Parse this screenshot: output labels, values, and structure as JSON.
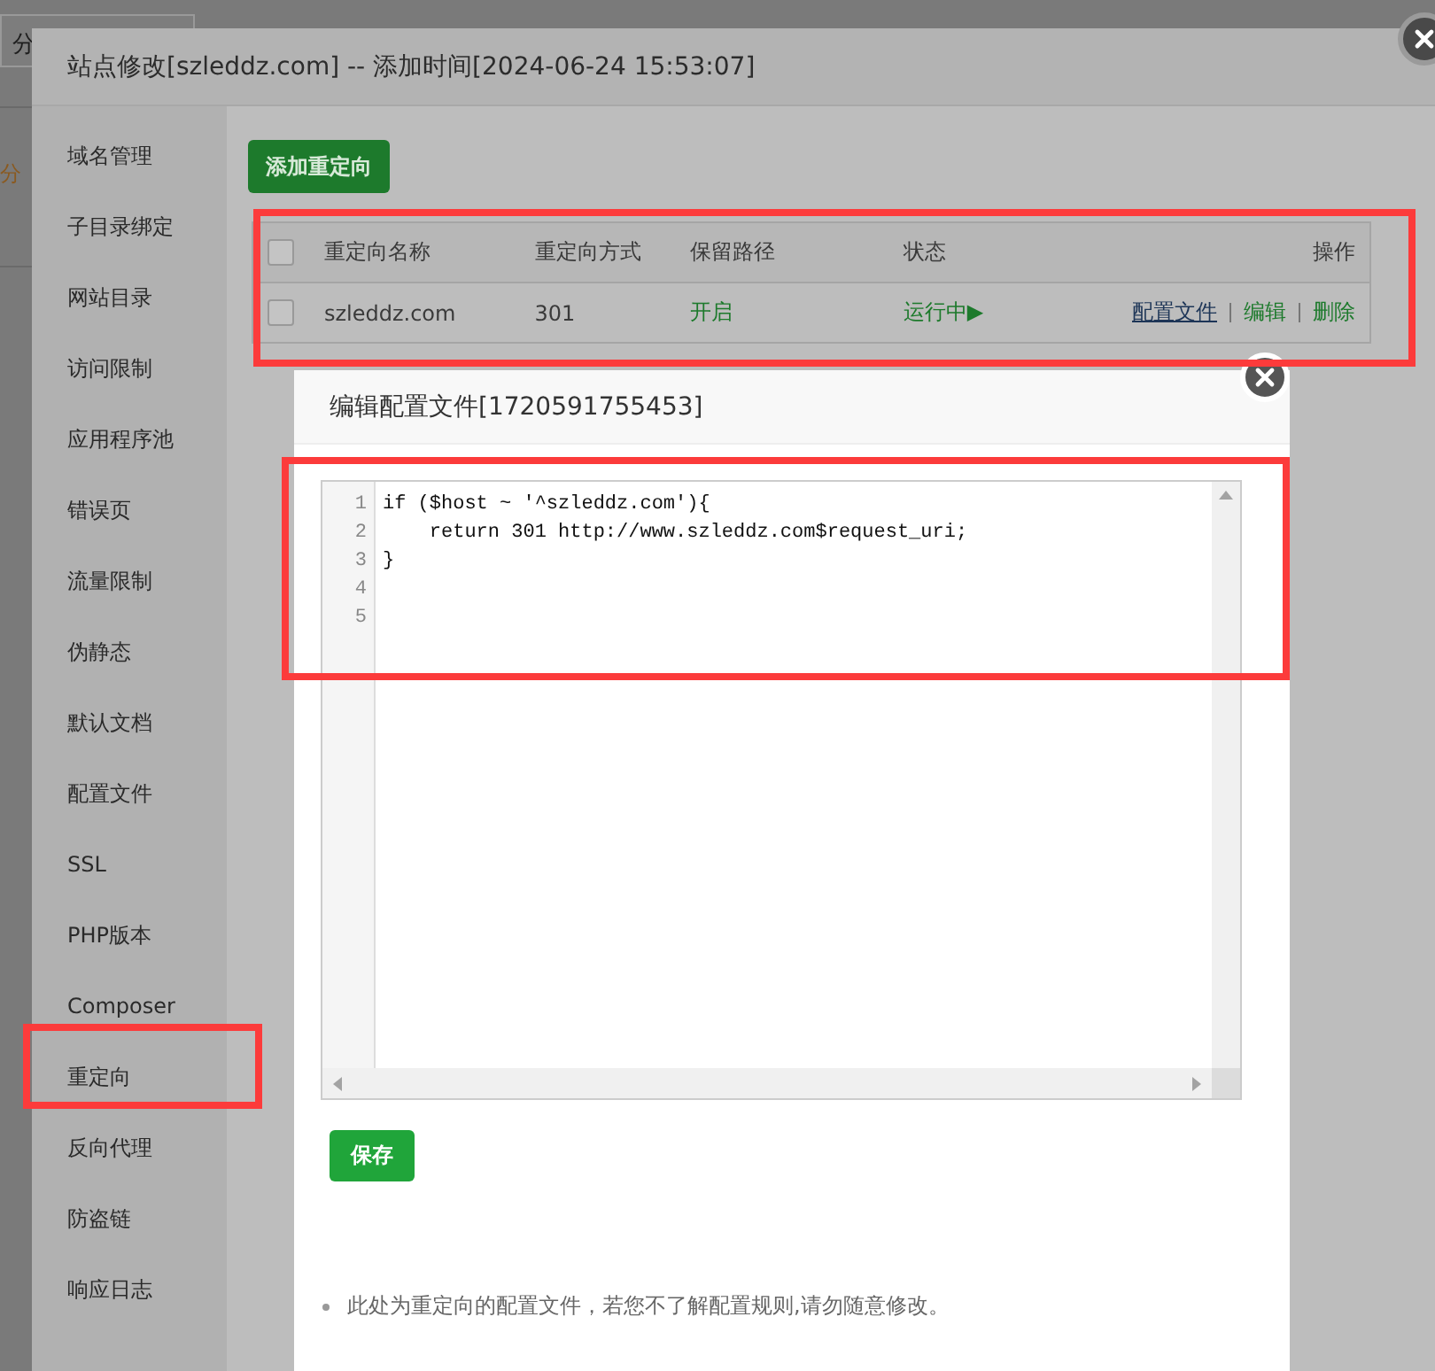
{
  "background_page": {
    "category_button": "分",
    "category_text": "分"
  },
  "site_dialog": {
    "title": "站点修改[szleddz.com] -- 添加时间[2024-06-24 15:53:07]",
    "sidebar": {
      "items": [
        {
          "label": "域名管理"
        },
        {
          "label": "子目录绑定"
        },
        {
          "label": "网站目录"
        },
        {
          "label": "访问限制"
        },
        {
          "label": "应用程序池"
        },
        {
          "label": "错误页"
        },
        {
          "label": "流量限制"
        },
        {
          "label": "伪静态"
        },
        {
          "label": "默认文档"
        },
        {
          "label": "配置文件"
        },
        {
          "label": "SSL"
        },
        {
          "label": "PHP版本"
        },
        {
          "label": "Composer"
        },
        {
          "label": "重定向"
        },
        {
          "label": "反向代理"
        },
        {
          "label": "防盗链"
        },
        {
          "label": "响应日志"
        }
      ]
    },
    "add_button": "添加重定向",
    "table": {
      "select_all_checked": false,
      "columns": [
        "重定向名称",
        "重定向方式",
        "保留路径",
        "状态",
        "操作"
      ],
      "rows": [
        {
          "checked": false,
          "name": "szleddz.com",
          "method": "301",
          "keep_path": "开启",
          "status": "运行中▶",
          "actions": [
            {
              "label": "配置文件",
              "kind": "link"
            },
            {
              "label": "编辑",
              "kind": "action"
            },
            {
              "label": "删除",
              "kind": "action"
            }
          ]
        }
      ]
    }
  },
  "config_dialog": {
    "title": "编辑配置文件[1720591755453]",
    "editor": {
      "lines": [
        {
          "number": "1",
          "code": "if ($host ~ '^szleddz.com'){"
        },
        {
          "number": "2",
          "code": "    return 301 http://www.szleddz.com$request_uri;"
        },
        {
          "number": "3",
          "code": "}"
        },
        {
          "number": "4"
        },
        {
          "number": "5"
        }
      ]
    },
    "save_button": "保存",
    "note": "此处为重定向的配置文件，若您不了解配置规则,请勿随意修改。"
  }
}
